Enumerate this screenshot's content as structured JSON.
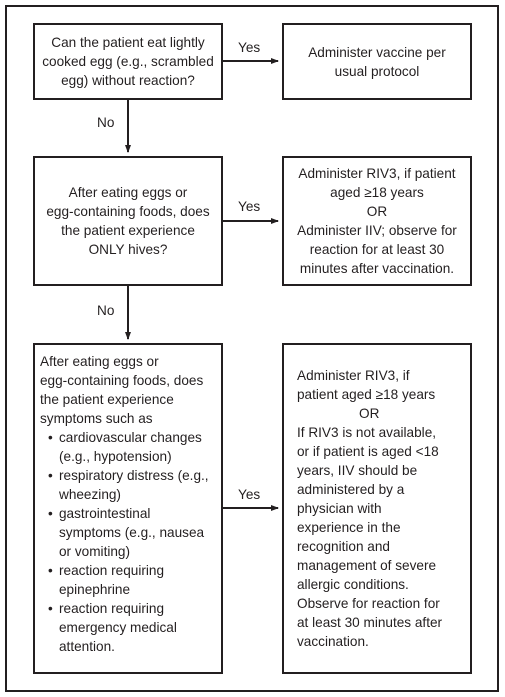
{
  "flowchart": {
    "q1": {
      "lines": [
        "Can the patient eat lightly",
        "cooked egg (e.g., scrambled",
        "egg) without reaction?"
      ]
    },
    "a1": {
      "lines": [
        "Administer vaccine per",
        "usual protocol"
      ]
    },
    "q2": {
      "lines": [
        "After eating eggs or",
        "egg-containing foods, does",
        "the patient experience",
        "ONLY hives?"
      ]
    },
    "a2": {
      "lines": [
        "Administer RIV3, if patient",
        "aged ≥18 years",
        "OR",
        "Administer IIV; observe for",
        "reaction for at least 30",
        "minutes after vaccination."
      ]
    },
    "q3": {
      "intro_lines": [
        "After eating eggs or",
        "egg-containing foods, does",
        "the patient experience",
        "symptoms such as"
      ],
      "bullet_char": "•",
      "bullets": [
        [
          "cardiovascular changes",
          "(e.g., hypotension)"
        ],
        [
          "respiratory distress (e.g.,",
          "wheezing)"
        ],
        [
          "gastrointestinal",
          "symptoms (e.g., nausea",
          "or vomiting)"
        ],
        [
          "reaction requiring",
          "epinephrine"
        ],
        [
          "reaction requiring",
          "emergency medical",
          "attention."
        ]
      ]
    },
    "a3": {
      "lines_before_or": [
        "Administer RIV3, if",
        "patient aged ≥18 years"
      ],
      "or_label": "OR",
      "lines_after_or": [
        "If RIV3 is not available,",
        "or if patient is aged <18",
        "years, IIV should be",
        "administered by a",
        "physician with",
        "experience in the",
        "recognition and",
        "management of severe",
        "allergic conditions.",
        "Observe for reaction for",
        "at least 30 minutes after",
        "vaccination."
      ]
    },
    "edge_labels": {
      "yes": "Yes",
      "no": "No"
    }
  }
}
